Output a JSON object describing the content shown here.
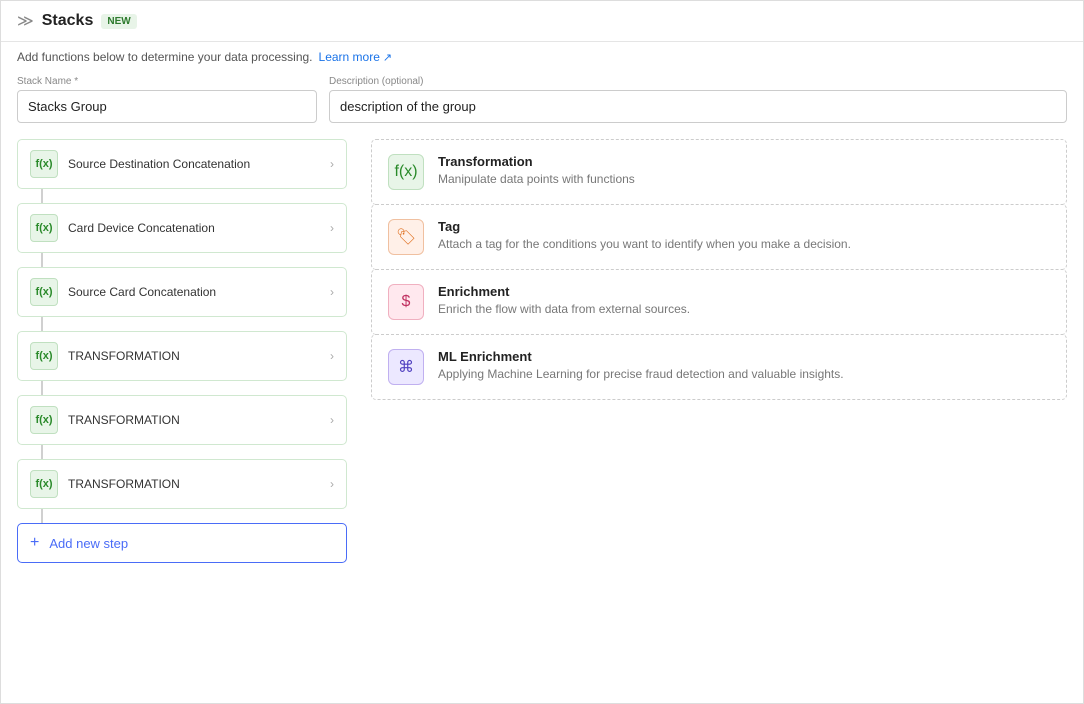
{
  "header": {
    "icon": "≫",
    "title": "Stacks",
    "badge": "NEW"
  },
  "subtitle": {
    "text": "Add functions below to determine your data processing.",
    "learn_more": "Learn more",
    "learn_more_icon": "↗"
  },
  "form": {
    "stack_name_label": "Stack Name *",
    "stack_name_value": "Stacks Group",
    "description_label": "Description (optional)",
    "description_value": "description of the group"
  },
  "steps": [
    {
      "label": "Source Destination Concatenation",
      "icon": "f(x)"
    },
    {
      "label": "Card Device Concatenation",
      "icon": "f(x)"
    },
    {
      "label": "Source Card Concatenation",
      "icon": "f(x)"
    },
    {
      "label": "TRANSFORMATION",
      "icon": "f(x)"
    },
    {
      "label": "TRANSFORMATION",
      "icon": "f(x)"
    },
    {
      "label": "TRANSFORMATION",
      "icon": "f(x)"
    }
  ],
  "add_step_label": "Add new step",
  "options": [
    {
      "title": "Transformation",
      "desc": "Manipulate data points with functions",
      "icon": "f(x)",
      "icon_type": "green",
      "icon_symbol": "f(x)"
    },
    {
      "title": "Tag",
      "desc": "Attach a tag for the conditions you want to identify when you make a decision.",
      "icon": "tag",
      "icon_type": "orange",
      "icon_symbol": "🏷"
    },
    {
      "title": "Enrichment",
      "desc": "Enrich the flow with data from external sources.",
      "icon": "enrichment",
      "icon_type": "pink",
      "icon_symbol": "$"
    },
    {
      "title": "ML Enrichment",
      "desc": "Applying Machine Learning for precise fraud detection and valuable insights.",
      "icon": "ml",
      "icon_type": "purple",
      "icon_symbol": "⌘"
    }
  ]
}
